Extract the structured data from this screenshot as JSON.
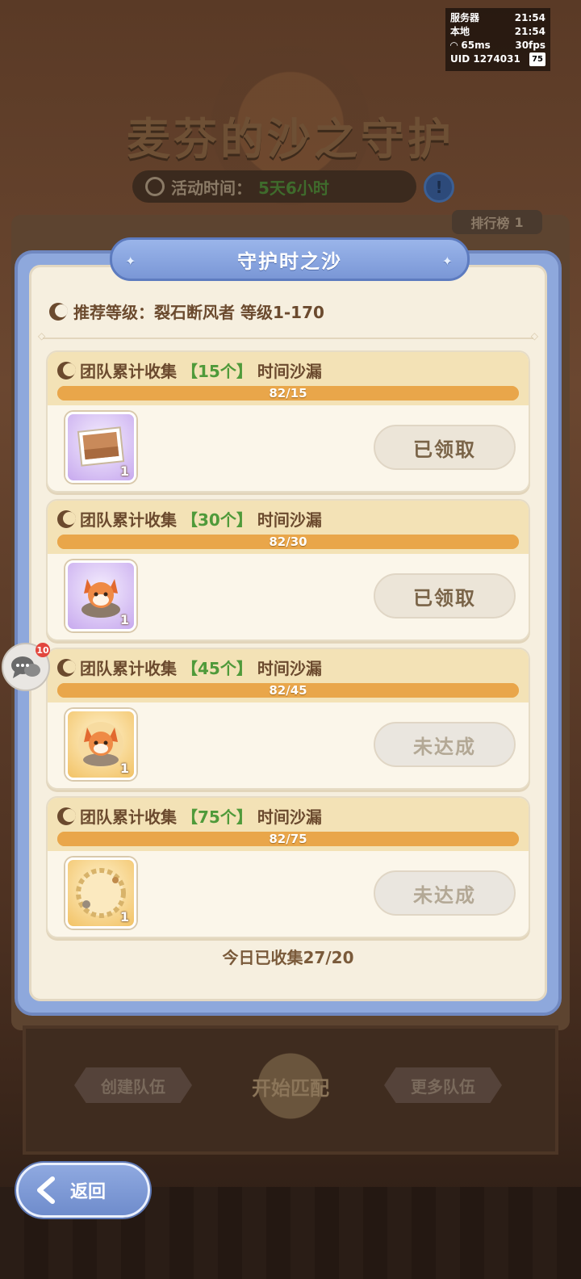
{
  "status": {
    "server_label": "服务器",
    "server_time": "21:54",
    "local_label": "本地",
    "local_time": "21:54",
    "ping": "65ms",
    "fps": "30fps",
    "uid": "UID 1274031",
    "battery": "75"
  },
  "background": {
    "event_title": "麦芬的沙之守护",
    "time_label": "活动时间：",
    "time_value": "5天6小时",
    "rank_label": "排行榜",
    "rank_number": "1",
    "create_team": "创建队伍",
    "start_match": "开始匹配",
    "more_teams": "更多队伍"
  },
  "modal": {
    "title": "守护时之沙",
    "recommend": "推荐等级：裂石断风者 等级1-170",
    "collected_today": "今日已收集27/20",
    "tasks": [
      {
        "prefix": "团队累计收集",
        "amount": "【15个】",
        "suffix": "时间沙漏",
        "progress_text": "82/15",
        "progress": 1.0,
        "reward_count": "1",
        "button": "已领取",
        "state": "claimed"
      },
      {
        "prefix": "团队累计收集",
        "amount": "【30个】",
        "suffix": "时间沙漏",
        "progress_text": "82/30",
        "progress": 1.0,
        "reward_count": "1",
        "button": "已领取",
        "state": "claimed"
      },
      {
        "prefix": "团队累计收集",
        "amount": "【45个】",
        "suffix": "时间沙漏",
        "progress_text": "82/45",
        "progress": 1.0,
        "reward_count": "1",
        "button": "未达成",
        "state": "pending"
      },
      {
        "prefix": "团队累计收集",
        "amount": "【75个】",
        "suffix": "时间沙漏",
        "progress_text": "82/75",
        "progress": 1.0,
        "reward_count": "1",
        "button": "未达成",
        "state": "pending"
      }
    ]
  },
  "chat_badge": "10",
  "back_label": "返回",
  "colors": {
    "accent_blue": "#8ea8dc",
    "progress_orange": "#e9a64a",
    "highlight_green": "#4f9a3a",
    "text_brown": "#6b4a2e"
  }
}
